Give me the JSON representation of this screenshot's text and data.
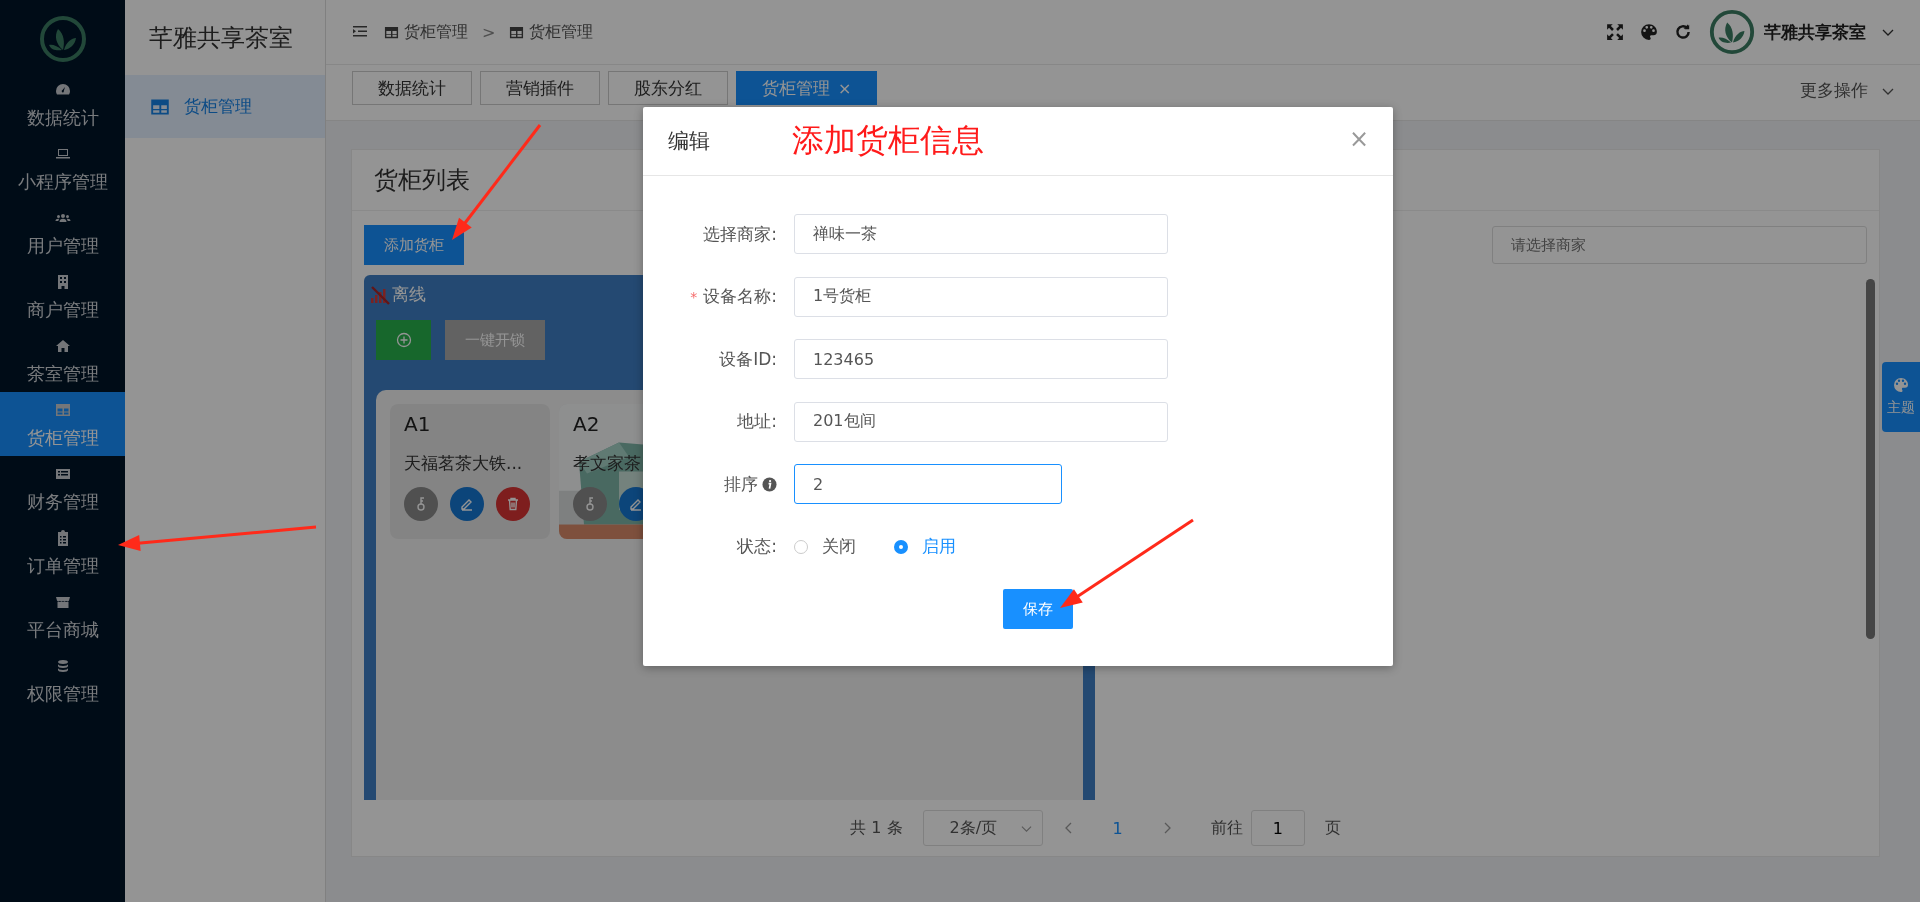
{
  "sidebar": {
    "items": [
      {
        "label": "数据统计",
        "selected": false
      },
      {
        "label": "小程序管理",
        "selected": false
      },
      {
        "label": "用户管理",
        "selected": false
      },
      {
        "label": "商户管理",
        "selected": false
      },
      {
        "label": "茶室管理",
        "selected": false
      },
      {
        "label": "货柜管理",
        "selected": true
      },
      {
        "label": "财务管理",
        "selected": false
      },
      {
        "label": "订单管理",
        "selected": false
      },
      {
        "label": "平台商城",
        "selected": false
      },
      {
        "label": "权限管理",
        "selected": false
      }
    ]
  },
  "subpanel": {
    "title": "芊雅共享茶室",
    "items": [
      {
        "label": "货柜管理",
        "selected": true
      }
    ]
  },
  "header": {
    "breadcrumb": [
      "货柜管理",
      ">",
      "货柜管理"
    ],
    "user": "芊雅共享茶室"
  },
  "tabs": [
    {
      "label": "数据统计",
      "selected": false
    },
    {
      "label": "营销插件",
      "selected": false
    },
    {
      "label": "股东分红",
      "selected": false
    },
    {
      "label": "货柜管理",
      "selected": true,
      "close": "×"
    }
  ],
  "more_actions": "更多操作",
  "card": {
    "title": "货柜列表",
    "add_button": "添加货柜",
    "merchant_filter": {
      "placeholder": "请选择商家"
    },
    "cabinet": {
      "status": "离线",
      "online": false,
      "unlock_button": "一键开锁",
      "slots": [
        {
          "code": "A1",
          "name": "天福茗茶大铁...",
          "kind": "plain"
        },
        {
          "code": "A2",
          "name": "孝文家茶",
          "kind": "picture"
        }
      ]
    },
    "pagination": {
      "total": "共 1 条",
      "page_size": "2条/页",
      "pages": [
        {
          "label": "1",
          "selected": true
        }
      ],
      "goto_label": "前往",
      "goto_value": "1",
      "goto_suffix": "页"
    }
  },
  "theme_tab": "主题",
  "dialog": {
    "title": "编辑",
    "annotation": "添加货柜信息",
    "close": "×",
    "fields": [
      {
        "kind": "input",
        "label": "选择商家:",
        "value": "禅味一茶"
      },
      {
        "kind": "input",
        "label": "设备名称:",
        "value": "1号货柜",
        "marker": "*"
      },
      {
        "kind": "input",
        "label": "设备ID:",
        "value": "123465"
      },
      {
        "kind": "input",
        "label": "地址:",
        "value": "201包间"
      },
      {
        "kind": "input",
        "label": "排序",
        "value": "2",
        "info": true,
        "focused": true
      },
      {
        "kind": "radio",
        "label": "状态:",
        "options": [
          {
            "label": "关闭",
            "selected": false
          },
          {
            "label": "启用",
            "selected": true
          }
        ]
      }
    ],
    "save": "保存"
  }
}
